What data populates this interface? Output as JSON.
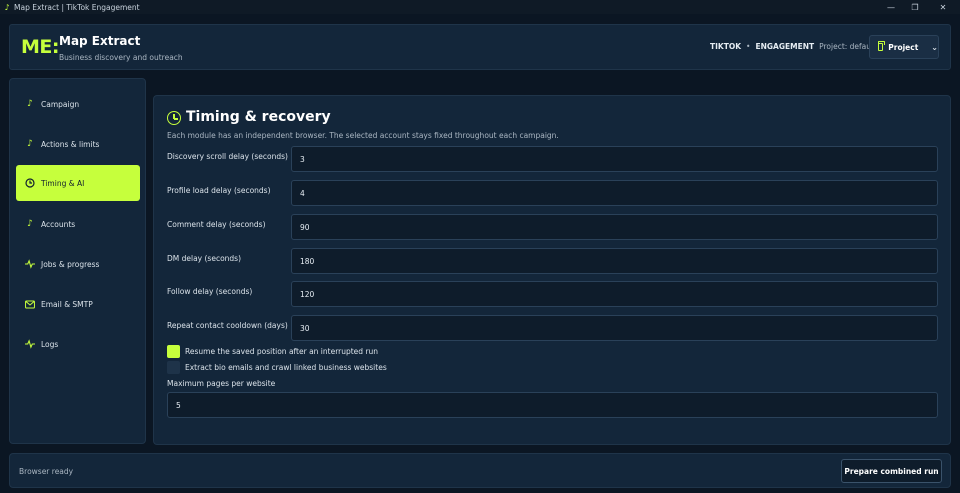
{
  "window": {
    "title": "Map Extract | TikTok Engagement",
    "icon": "tiktok-icon"
  },
  "header": {
    "logo": "ME:",
    "app_name": "Map Extract",
    "subtitle": "Business discovery and outreach",
    "platform": "TIKTOK",
    "separator": "•",
    "mode": "ENGAGEMENT",
    "project_context": "Project: default",
    "project_button": "Project"
  },
  "sidebar": {
    "items": [
      {
        "label": "Campaign",
        "icon": "tiktok-icon",
        "active": false
      },
      {
        "label": "Actions & limits",
        "icon": "tiktok-icon",
        "active": false
      },
      {
        "label": "Timing & AI",
        "icon": "clock-icon",
        "active": true
      },
      {
        "label": "Accounts",
        "icon": "tiktok-icon",
        "active": false
      },
      {
        "label": "Jobs & progress",
        "icon": "pulse-icon",
        "active": false
      },
      {
        "label": "Email & SMTP",
        "icon": "mail-icon",
        "active": false
      },
      {
        "label": "Logs",
        "icon": "pulse-icon",
        "active": false
      }
    ]
  },
  "main": {
    "title": "Timing & recovery",
    "description": "Each module has an independent browser. The selected account stays fixed throughout each campaign.",
    "fields": [
      {
        "label": "Discovery scroll delay (seconds)",
        "value": "3"
      },
      {
        "label": "Profile load delay (seconds)",
        "value": "4"
      },
      {
        "label": "Comment delay (seconds)",
        "value": "90"
      },
      {
        "label": "DM delay (seconds)",
        "value": "180"
      },
      {
        "label": "Follow delay (seconds)",
        "value": "120"
      },
      {
        "label": "Repeat contact cooldown (days)",
        "value": "30"
      }
    ],
    "checkboxes": [
      {
        "label": "Resume the saved position after an interrupted run",
        "checked": true
      },
      {
        "label": "Extract bio emails and crawl linked business websites",
        "checked": false
      }
    ],
    "max_pages": {
      "label": "Maximum pages per website",
      "value": "5"
    }
  },
  "footer": {
    "status": "Browser ready",
    "run_button": "Prepare combined run"
  },
  "colors": {
    "accent": "#c6ff3c",
    "background": "#0b1623",
    "panel": "#13263a"
  }
}
